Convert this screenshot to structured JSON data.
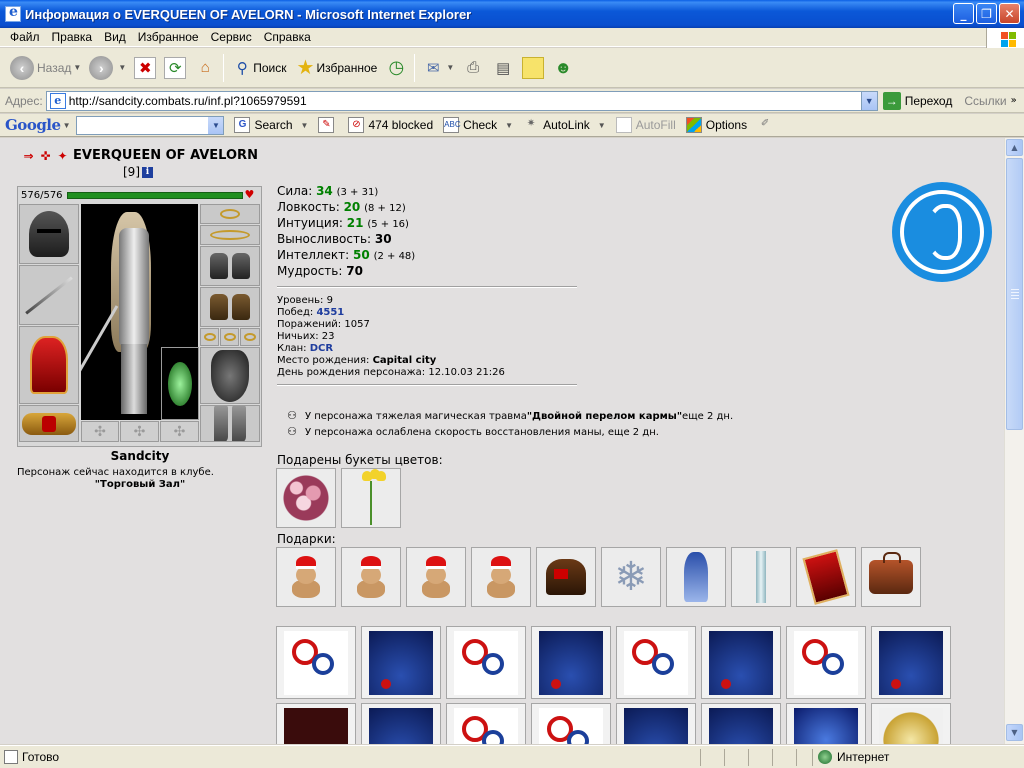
{
  "window": {
    "title": "Информация о EVERQUEEN OF AVELORN - Microsoft Internet Explorer"
  },
  "menu": [
    "Файл",
    "Правка",
    "Вид",
    "Избранное",
    "Сервис",
    "Справка"
  ],
  "toolbar": {
    "back": "Назад",
    "search": "Поиск",
    "favorites": "Избранное"
  },
  "address": {
    "label": "Адрес:",
    "url": "http://sandcity.combats.ru/inf.pl?1065979591",
    "go": "Переход",
    "links": "Ссылки"
  },
  "google_bar": {
    "logo": "Google",
    "search": "Search",
    "blocked": "474 blocked",
    "check": "Check",
    "autolink": "AutoLink",
    "autofill": "AutoFill",
    "options": "Options"
  },
  "character": {
    "name": "EVERQUEEN OF AVELORN",
    "level": "[9]",
    "hp": "576/576",
    "city": "Sandcity",
    "location_text": "Персонаж сейчас находится в клубе.",
    "location_place": "\"Торговый Зал\""
  },
  "stats": [
    {
      "label": "Сила:",
      "value": "34",
      "extra": "(3 + 31)",
      "green": true
    },
    {
      "label": "Ловкость:",
      "value": "20",
      "extra": "(8 + 12)",
      "green": true
    },
    {
      "label": "Интуиция:",
      "value": "21",
      "extra": "(5 + 16)",
      "green": true
    },
    {
      "label": "Выносливость:",
      "value": "30",
      "extra": "",
      "green": false
    },
    {
      "label": "Интеллект:",
      "value": "50",
      "extra": "(2 + 48)",
      "green": true
    },
    {
      "label": "Мудрость:",
      "value": "70",
      "extra": "",
      "green": false
    }
  ],
  "info": {
    "level_label": "Уровень:",
    "level": "9",
    "wins_label": "Побед:",
    "wins": "4551",
    "losses_label": "Поражений:",
    "losses": "1057",
    "draws_label": "Ничьих:",
    "draws": "23",
    "clan_label": "Клан:",
    "clan": "DCR",
    "birthplace_label": "Место рождения:",
    "birthplace": "Capital city",
    "birthday_label": "День рождения персонажа:",
    "birthday": "12.10.03 21:26"
  },
  "effects": {
    "trauma_pre": "У персонажа тяжелая магическая травма ",
    "trauma_name": "\"Двойной перелом кармы\"",
    "trauma_post": " еще 2 дн.",
    "mana": "У персонажа ослаблена скорость восстановления маны, еще 2 дн."
  },
  "sections": {
    "flowers": "Подарены букеты цветов:",
    "gifts": "Подарки:"
  },
  "status": {
    "text": "Готово",
    "zone": "Интернет"
  }
}
